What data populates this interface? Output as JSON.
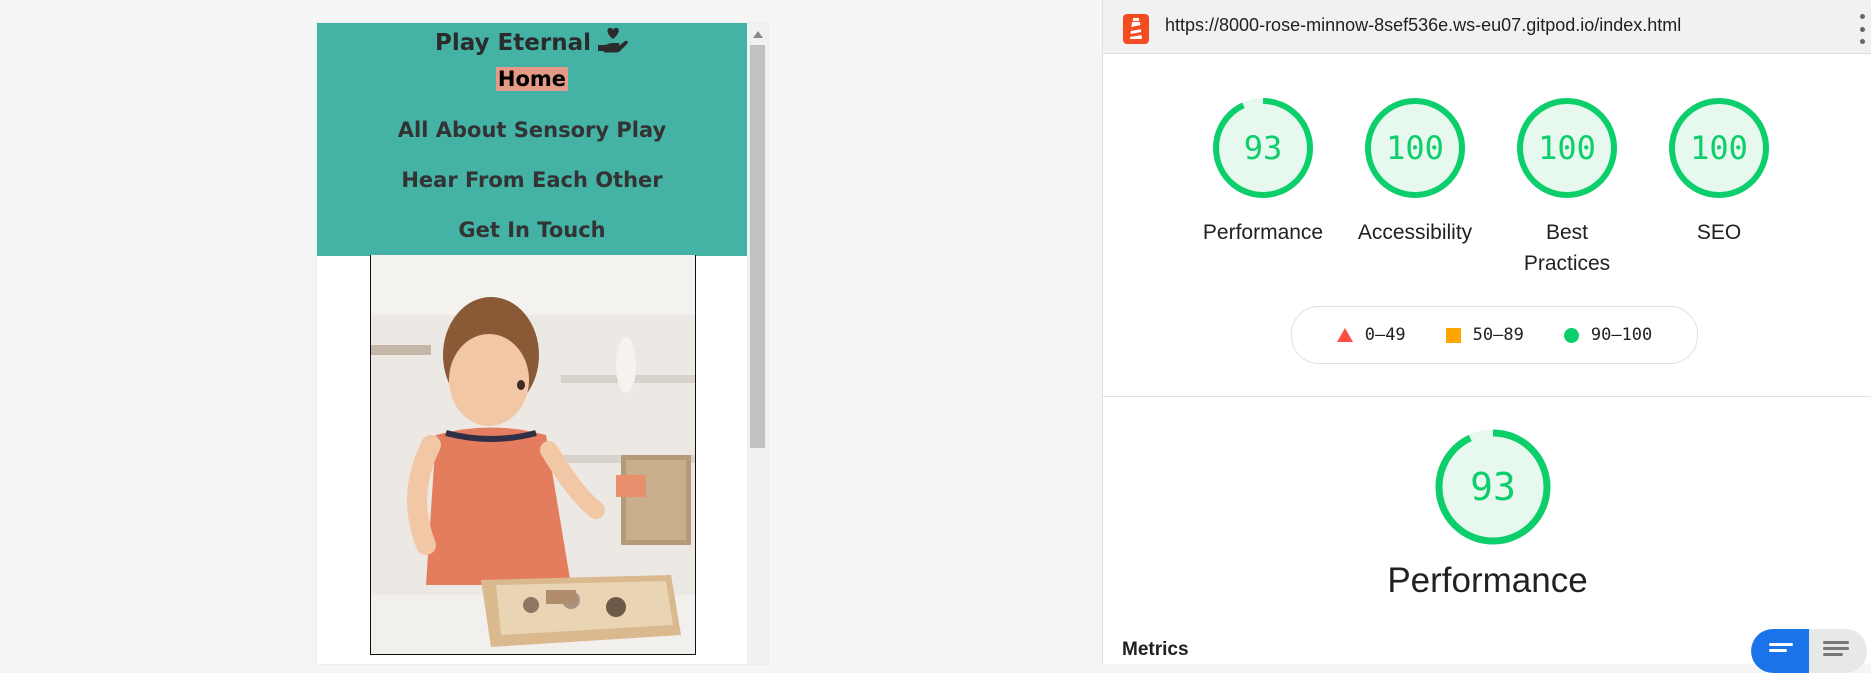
{
  "site": {
    "brand": "Play Eternal",
    "brand_icon": "hand-holding-heart-icon",
    "nav": [
      {
        "label": "Home",
        "active": true
      },
      {
        "label": "All About Sensory Play",
        "active": false
      },
      {
        "label": "Hear From Each Other",
        "active": false
      },
      {
        "label": "Get In Touch",
        "active": false
      }
    ],
    "colors": {
      "nav_bg": "#45b2a6",
      "active_highlight": "#e49a86"
    }
  },
  "lighthouse": {
    "url": "https://8000-rose-minnow-8sef536e.ws-eu07.gitpod.io/index.html",
    "categories": [
      {
        "score": "93",
        "label": "Performance",
        "value": 93
      },
      {
        "score": "100",
        "label": "Accessibility",
        "value": 100
      },
      {
        "score": "100",
        "label": "Best Practices",
        "value": 100
      },
      {
        "score": "100",
        "label": "SEO",
        "value": 100
      }
    ],
    "legend": [
      {
        "range": "0–49",
        "color": "#ff4e42"
      },
      {
        "range": "50–89",
        "color": "#ffa400"
      },
      {
        "range": "90–100",
        "color": "#0cce6b"
      }
    ],
    "performance": {
      "score": "93",
      "value": 93,
      "title": "Performance"
    },
    "metrics_label": "Metrics",
    "colors": {
      "pass": "#0cce6b",
      "pass_bg": "#e7f8ee",
      "toggle_active": "#1a73e8"
    }
  }
}
